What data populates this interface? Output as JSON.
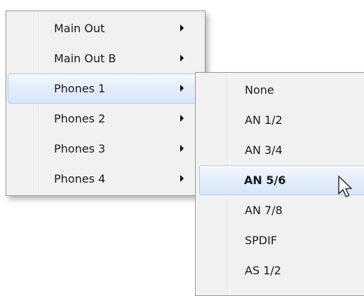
{
  "main_menu": {
    "items": [
      {
        "label": "Main Out",
        "has_submenu": true,
        "highlighted": false
      },
      {
        "label": "Main Out B",
        "has_submenu": true,
        "highlighted": false
      },
      {
        "label": "Phones 1",
        "has_submenu": true,
        "highlighted": true
      },
      {
        "label": "Phones 2",
        "has_submenu": true,
        "highlighted": false
      },
      {
        "label": "Phones 3",
        "has_submenu": true,
        "highlighted": false
      },
      {
        "label": "Phones 4",
        "has_submenu": true,
        "highlighted": false
      }
    ]
  },
  "submenu": {
    "items": [
      {
        "label": "None",
        "highlighted": false
      },
      {
        "label": "AN 1/2",
        "highlighted": false
      },
      {
        "label": "AN 3/4",
        "highlighted": false
      },
      {
        "label": "AN 5/6",
        "highlighted": true,
        "bold": true
      },
      {
        "label": "AN 7/8",
        "highlighted": false
      },
      {
        "label": "SPDIF",
        "highlighted": false
      },
      {
        "label": "AS 1/2",
        "highlighted": false
      }
    ]
  },
  "colors": {
    "menu_background": "#f1f1f1",
    "menu_border": "#979797",
    "highlight_border": "#aecbf0",
    "highlight_fill": "#e4eefb"
  },
  "icons": {
    "submenu_arrow": "arrow-right-icon",
    "pointer": "mouse-cursor-icon"
  }
}
